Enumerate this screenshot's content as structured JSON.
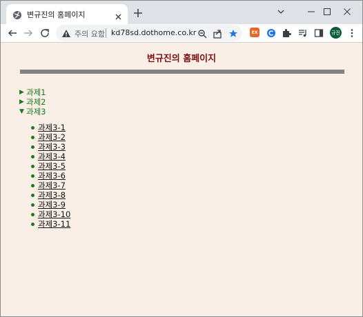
{
  "browser": {
    "tab_title": "변규진의 홈페이지",
    "security_label": "주의 요함",
    "url": "kd78sd.dothome.co.kr",
    "extension_badge": "EX",
    "profile_initials": "규진",
    "accent_color": "#1a73e8",
    "icons": [
      "globe-icon",
      "close-icon",
      "plus-icon",
      "chevron-down-icon",
      "minimize-icon",
      "maximize-icon",
      "window-close-icon",
      "back-arrow-icon",
      "forward-arrow-icon",
      "reload-icon",
      "warning-icon",
      "zoom-icon",
      "share-icon",
      "star-icon",
      "extension-c-icon",
      "puzzle-icon",
      "media-icon",
      "sidepanel-icon",
      "kebab-menu-icon"
    ]
  },
  "page": {
    "title": "변규진의 홈페이지",
    "title_color": "#7a0f10",
    "text_color": "#1a7a1a",
    "background": "#f9efe6",
    "sections": [
      {
        "label": "과제1",
        "expanded": false
      },
      {
        "label": "과제2",
        "expanded": false
      },
      {
        "label": "과제3",
        "expanded": true
      }
    ],
    "links": [
      "과제3-1",
      "과제3-2",
      "과제3-3",
      "과제3-4",
      "과제3-5",
      "과제3-6",
      "과제3-7",
      "과제3-8",
      "과제3-9",
      "과제3-10",
      "과제3-11"
    ]
  }
}
